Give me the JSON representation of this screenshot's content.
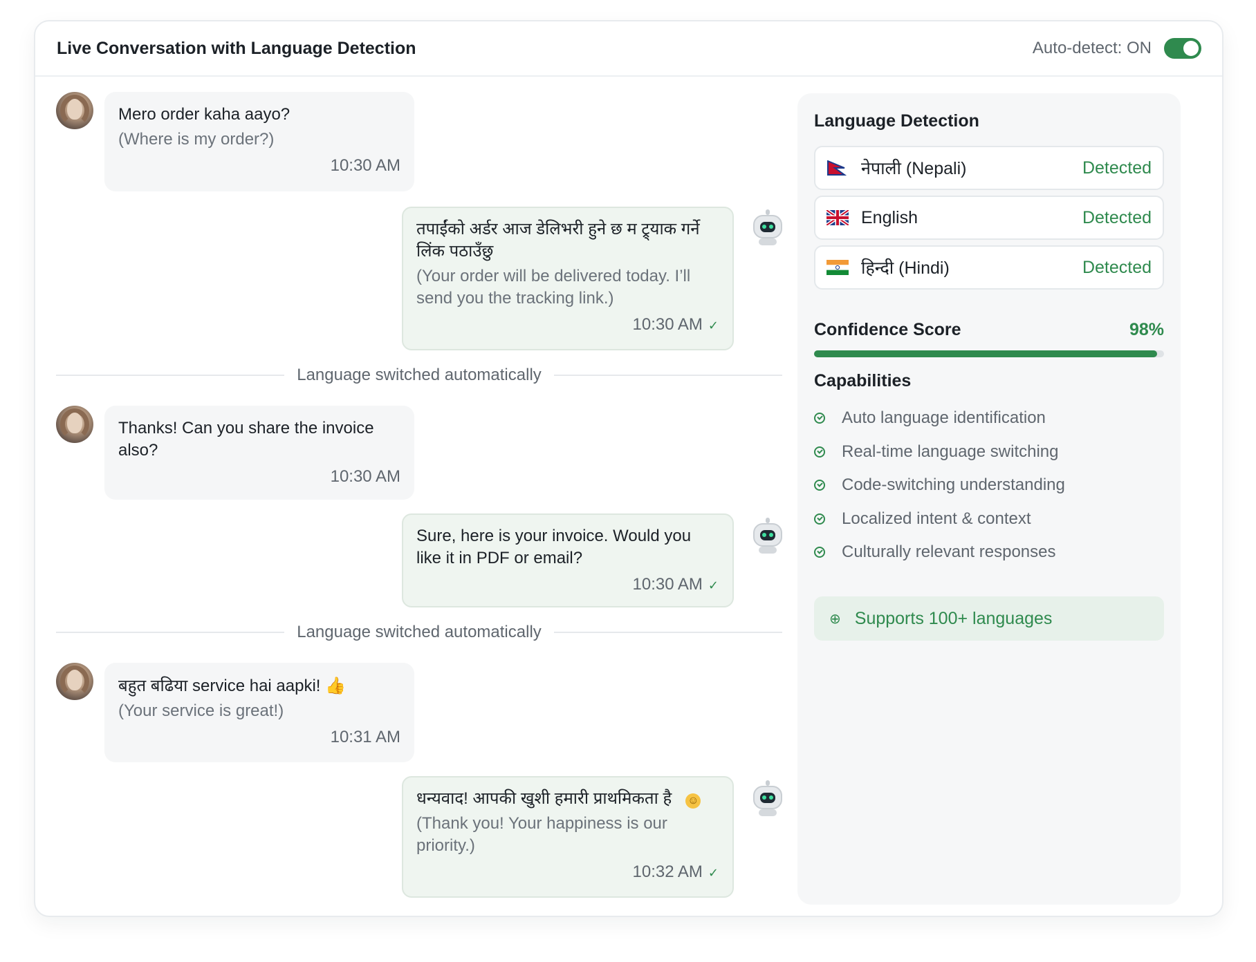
{
  "header": {
    "title": "Live Conversation with Language Detection",
    "auto_detect_label": "Auto-detect: ON",
    "auto_detect_on": true
  },
  "messages": [
    {
      "from": "user",
      "main": "Mero order kaha aayo?",
      "sub": "(Where is my order?)",
      "time": "10:30 AM"
    },
    {
      "from": "bot",
      "main": "तपाईंको अर्डर आज डेलिभरी हुने छ     म ट्र्याक गर्ने लिंक पठाउँछु",
      "sub": "(Your order will be delivered today. I’ll send you the tracking link.)",
      "time": "10:30 AM"
    },
    {
      "from": "user",
      "main": "Thanks! Can you share the invoice also?",
      "sub": "",
      "time": "10:30 AM"
    },
    {
      "from": "bot",
      "main": "Sure, here is your invoice. Would you like it in PDF or email?",
      "sub": "",
      "time": "10:30 AM"
    },
    {
      "from": "user",
      "main": "बहुत बढिया service hai aapki!",
      "sub": "(Your service is great!)",
      "time": "10:31 AM",
      "emoji": "👍"
    },
    {
      "from": "bot",
      "main": "धन्यवाद! आपकी खुशी हमारी प्राथमिकता है",
      "sub": "(Thank you! Your happiness is our priority.)",
      "time": "10:32 AM",
      "emoji": "😊"
    }
  ],
  "dividers": [
    "Language switched automatically",
    "Language switched automatically"
  ],
  "panel": {
    "title": "Language Detection",
    "languages": [
      {
        "name": "नेपाली (Nepali)",
        "status": "Detected",
        "flag": "nepal-flag"
      },
      {
        "name": "English",
        "status": "Detected",
        "flag": "uk-flag"
      },
      {
        "name": "हिन्दी (Hindi)",
        "status": "Detected",
        "flag": "india-flag"
      }
    ],
    "confidence_label": "Confidence Score",
    "confidence_value": "98%",
    "confidence_fraction": 0.98,
    "capabilities_title": "Capabilities",
    "capabilities": [
      "Auto language identification",
      "Real-time language switching",
      "Code-switching understanding",
      "Localized intent & context",
      "Culturally relevant responses"
    ],
    "support_text": "Supports 100+ languages"
  },
  "colors": {
    "accent": "#2f8a4e",
    "bot_bubble": "#eff5f0",
    "user_bubble": "#f5f6f7",
    "support_bg": "#e7f1ea"
  }
}
